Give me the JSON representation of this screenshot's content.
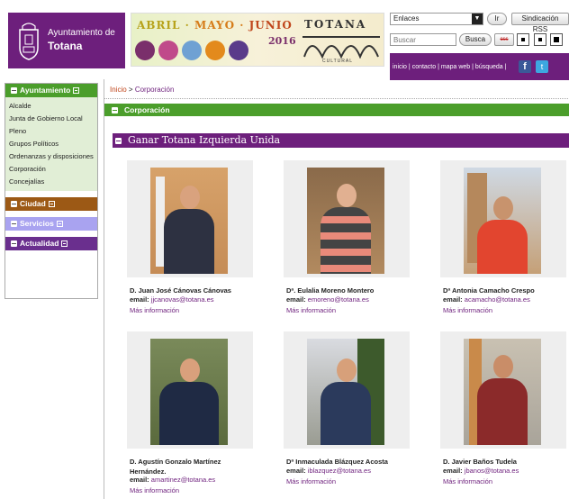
{
  "header": {
    "logo_line1": "Ayuntamiento de",
    "logo_line2": "Totana",
    "banner": {
      "m1": "ABRIL ·",
      "m2": "MAYO ·",
      "m3": "JUNIO",
      "year": "2016",
      "brand": "TOTANA",
      "sub": "CULTURAL"
    },
    "tools": {
      "select_value": "Enlaces",
      "go_label": "Ir",
      "rss_label": "Sindicación RSS",
      "search_placeholder": "Buscar",
      "search_label": "Busca",
      "css_label": "css"
    },
    "topnav": {
      "inicio": "inicio",
      "contacto": "contacto",
      "mapa": "mapa web",
      "busqueda": "búsqueda",
      "sep": "|"
    }
  },
  "sidebar": {
    "ayto": "Ayuntamiento",
    "items": [
      "Alcalde",
      "Junta de Gobierno Local",
      "Pleno",
      "Grupos Políticos",
      "Ordenanzas y disposiciones",
      "Corporación",
      "Concejalías"
    ],
    "ciudad": "Ciudad",
    "servicios": "Servicios",
    "actualidad": "Actualidad"
  },
  "main": {
    "crumb_home": "Inicio",
    "crumb_sep": ">",
    "crumb_current": "Corporación",
    "section_title": "Corporación",
    "party": "Ganar Totana Izquierda Unida",
    "email_label": "email:",
    "more_label": "Más información",
    "members": [
      {
        "name": "D. Juan José Cánovas Cánovas",
        "email": "jjcanovas@totana.es"
      },
      {
        "name": "Dª. Eulalia Moreno Montero",
        "email": "emoreno@totana.es"
      },
      {
        "name": "Dª Antonia Camacho Crespo",
        "email": "acamacho@totana.es"
      },
      {
        "name": "D. Agustín Gonzalo Martínez Hernández.",
        "email": "amartinez@totana.es"
      },
      {
        "name": "Dª Inmaculada Blázquez Acosta",
        "email": "iblazquez@totana.es"
      },
      {
        "name": "D. Javier Baños Tudela",
        "email": "jbanos@totana.es"
      }
    ]
  },
  "colors": {
    "purple": "#6d1f7c",
    "green": "#4b9e2b",
    "brown": "#9c5915",
    "lilac": "#a9a3f0"
  }
}
